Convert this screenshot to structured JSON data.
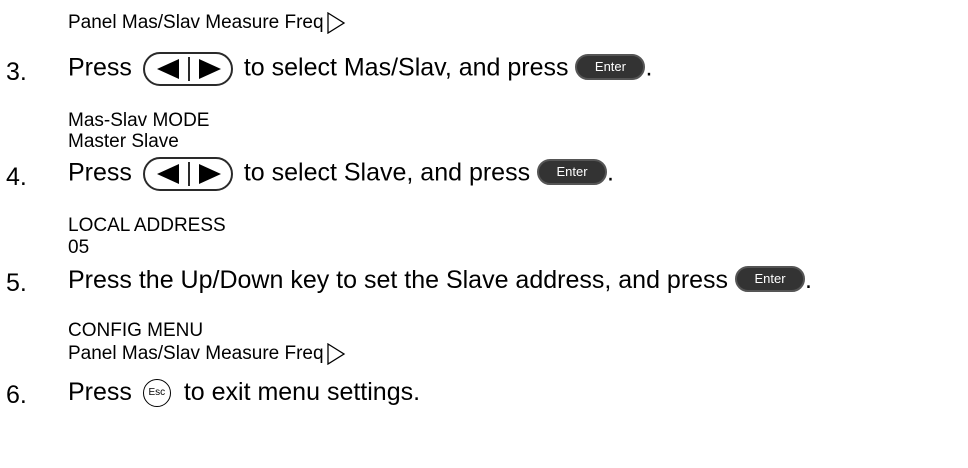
{
  "lcd1": {
    "line1": "Panel Mas/Slav Measure Freq"
  },
  "step3": {
    "number": "3.",
    "pre": "Press",
    "mid": "to select Mas/Slav, and press",
    "end": "."
  },
  "lcd2": {
    "line1": "Mas-Slav MODE",
    "line2": "Master Slave"
  },
  "step4": {
    "number": "4.",
    "pre": "Press",
    "mid": "to select Slave, and press",
    "end": "."
  },
  "lcd3": {
    "line1": "LOCAL ADDRESS",
    "line2": "05"
  },
  "step5": {
    "number": "5.",
    "text": "Press the Up/Down key to set the Slave address, and press",
    "end": "."
  },
  "lcd4": {
    "line1": "CONFIG MENU",
    "line2": "Panel Mas/Slav Measure Freq"
  },
  "step6": {
    "number": "6.",
    "pre": "Press",
    "post": "to exit menu settings."
  },
  "keys": {
    "enter_label": "Enter",
    "esc_label": "Esc"
  },
  "icons": {
    "arrows_key": "left-right-arrow-keys-icon",
    "menu_arrow": "right-triangle-outline-icon"
  }
}
